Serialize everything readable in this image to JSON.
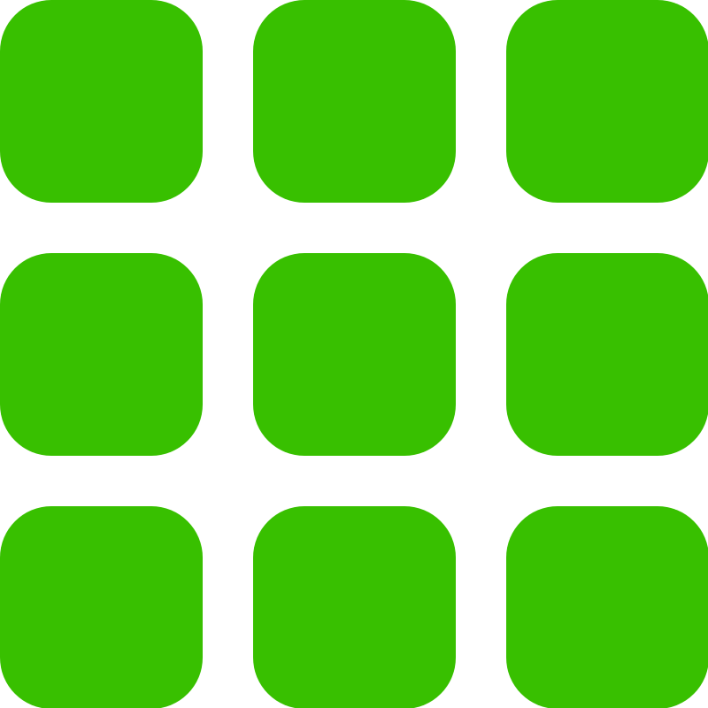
{
  "icon": {
    "name": "app-grid-icon",
    "color": "#38c000",
    "rows": 3,
    "columns": 3,
    "tiles": [
      {
        "row": 1,
        "col": 1
      },
      {
        "row": 1,
        "col": 2
      },
      {
        "row": 1,
        "col": 3
      },
      {
        "row": 2,
        "col": 1
      },
      {
        "row": 2,
        "col": 2
      },
      {
        "row": 2,
        "col": 3
      },
      {
        "row": 3,
        "col": 1
      },
      {
        "row": 3,
        "col": 2
      },
      {
        "row": 3,
        "col": 3
      }
    ]
  }
}
